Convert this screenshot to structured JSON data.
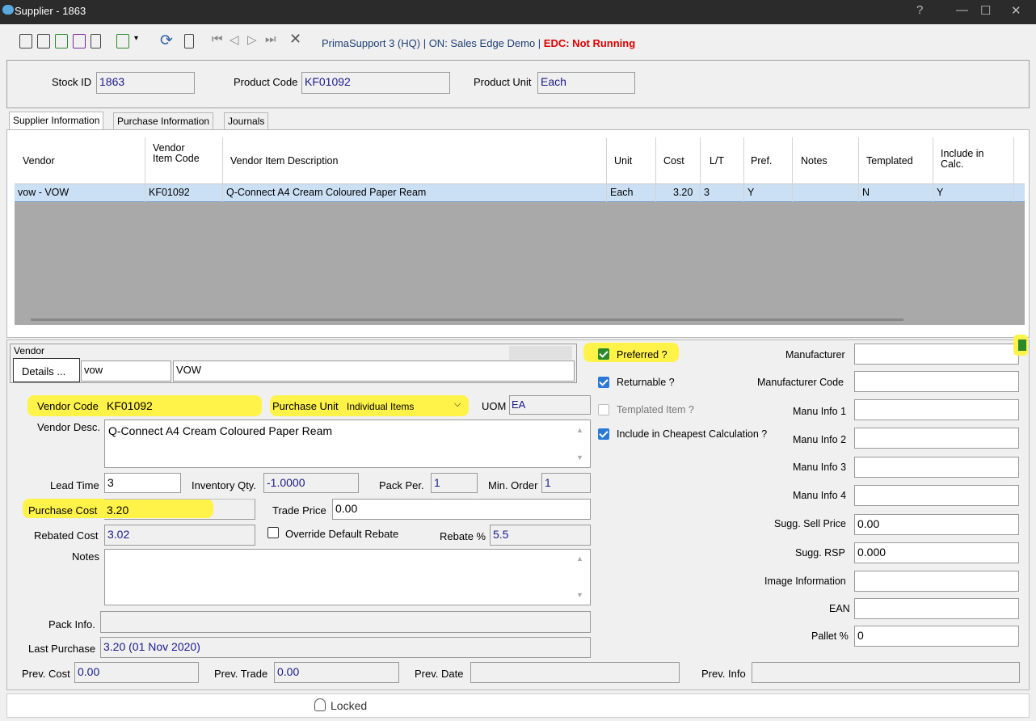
{
  "window": {
    "title": "Supplier - 1863",
    "help": "?",
    "minimize": "—",
    "maximize": "☐",
    "close": "✕"
  },
  "toolbar": {
    "connection": "PrimaSupport 3 (HQ) | ON: Sales Edge Demo | ",
    "edc": "EDC: Not Running"
  },
  "header": {
    "stock_id_label": "Stock ID",
    "stock_id": "1863",
    "product_code_label": "Product Code",
    "product_code": "KF01092",
    "product_unit_label": "Product Unit",
    "product_unit": "Each"
  },
  "tabs": [
    "Supplier Information",
    "Purchase Information",
    "Journals"
  ],
  "grid": {
    "columns": [
      "Vendor",
      "Vendor Item Code",
      "Vendor Item Description",
      "Unit",
      "Cost",
      "L/T",
      "Pref.",
      "Notes",
      "Templated",
      "Include in Calc."
    ],
    "row": [
      "vow - VOW",
      "KF01092",
      "Q-Connect A4 Cream Coloured Paper Ream",
      "Each",
      "3.20",
      "3",
      "Y",
      "",
      "N",
      "Y"
    ]
  },
  "vendor": {
    "group_label": "Vendor",
    "details_button": "Details ...",
    "code": "vow",
    "name": "VOW",
    "vendor_code_label": "Vendor Code",
    "vendor_code": "KF01092",
    "purchase_unit_label": "Purchase Unit",
    "purchase_unit": "Individual Items",
    "uom_label": "UOM",
    "uom": "EA",
    "vendor_desc_label": "Vendor Desc.",
    "vendor_desc": "Q-Connect A4 Cream Coloured Paper Ream",
    "lead_time_label": "Lead Time",
    "lead_time": "3",
    "inventory_qty_label": "Inventory Qty.",
    "inventory_qty": "-1.0000",
    "pack_per_label": "Pack Per.",
    "pack_per": "1",
    "min_order_label": "Min. Order",
    "min_order": "1",
    "purchase_cost_label": "Purchase Cost",
    "purchase_cost": "3.20",
    "trade_price_label": "Trade Price",
    "trade_price": "0.00",
    "rebated_cost_label": "Rebated Cost",
    "rebated_cost": "3.02",
    "override_label": "Override Default Rebate",
    "rebate_label": "Rebate %",
    "rebate": "5.5",
    "notes_label": "Notes",
    "notes": "",
    "pack_info_label": "Pack Info.",
    "pack_info": "",
    "last_purchase_label": "Last Purchase",
    "last_purchase": "3.20  (01 Nov 2020)",
    "prev_cost_label": "Prev. Cost",
    "prev_cost": "0.00",
    "prev_trade_label": "Prev. Trade",
    "prev_trade": "0.00",
    "prev_date_label": "Prev. Date",
    "prev_date": "",
    "prev_info_label": "Prev. Info",
    "prev_info": ""
  },
  "flags": {
    "preferred": "Preferred ?",
    "returnable": "Returnable ?",
    "templated": "Templated Item ?",
    "cheapest": "Include in Cheapest Calculation ?"
  },
  "manu": {
    "manufacturer_label": "Manufacturer",
    "manufacturer": "",
    "manufacturer_code_label": "Manufacturer Code",
    "manufacturer_code": "",
    "info1_label": "Manu Info 1",
    "info2_label": "Manu Info 2",
    "info3_label": "Manu Info 3",
    "info4_label": "Manu Info 4",
    "sugg_sell_label": "Sugg. Sell Price",
    "sugg_sell": "0.00",
    "sugg_rsp_label": "Sugg. RSP",
    "sugg_rsp": "0.000",
    "image_info_label": "Image Information",
    "ean_label": "EAN",
    "ean": "",
    "pallet_label": "Pallet %",
    "pallet": "0"
  },
  "status": {
    "locked": "Locked"
  }
}
